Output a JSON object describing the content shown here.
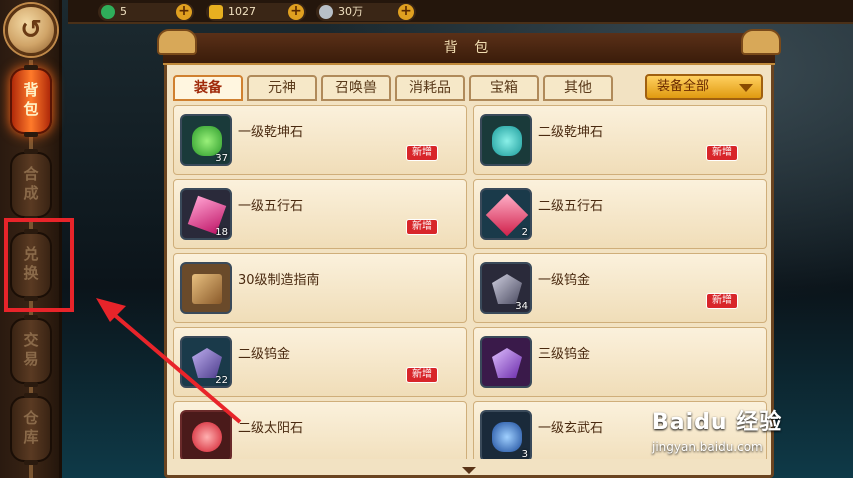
{
  "resources": [
    {
      "name": "jade",
      "value": "5",
      "icon": "jade-icon",
      "color": "#2fae5a"
    },
    {
      "name": "gold",
      "value": "1027",
      "icon": "gold-ingot-icon",
      "color": "#e8b020"
    },
    {
      "name": "silver",
      "value": "30万",
      "icon": "silver-ingot-icon",
      "color": "#b8c0c8"
    }
  ],
  "nav": {
    "back_icon": "back-arrow-icon",
    "items": [
      {
        "label": "背包",
        "active": true
      },
      {
        "label": "合成",
        "active": false
      },
      {
        "label": "兑换",
        "active": false
      },
      {
        "label": "交易",
        "active": false
      },
      {
        "label": "仓库",
        "active": false
      }
    ]
  },
  "panel": {
    "title": "背 包",
    "tabs": [
      "装备",
      "元神",
      "召唤兽",
      "消耗品",
      "宝箱",
      "其他"
    ],
    "active_tab": "装备",
    "filter_label": "装备全部"
  },
  "items": [
    {
      "name": "一级乾坤石",
      "count": "37",
      "new": "新增",
      "color": "#3ac03a"
    },
    {
      "name": "二级乾坤石",
      "count": "",
      "new": "新增",
      "color": "#30c0b0"
    },
    {
      "name": "一级五行石",
      "count": "18",
      "new": "新增",
      "color": "#e0408a"
    },
    {
      "name": "二级五行石",
      "count": "2",
      "new": "",
      "color": "#e84a70"
    },
    {
      "name": "30级制造指南",
      "count": "",
      "new": "",
      "color": "#a8763a"
    },
    {
      "name": "一级钨金",
      "count": "34",
      "new": "新增",
      "color": "#7a7a90"
    },
    {
      "name": "二级钨金",
      "count": "22",
      "new": "新增",
      "color": "#7a6aa8"
    },
    {
      "name": "三级钨金",
      "count": "",
      "new": "",
      "color": "#9a5ac8"
    },
    {
      "name": "二级太阳石",
      "count": "",
      "new": "",
      "color": "#e8303a"
    },
    {
      "name": "一级玄武石",
      "count": "3",
      "new": "",
      "color": "#3a7ad8"
    }
  ],
  "watermark": {
    "main": "Baidu 经验",
    "sub": "jingyan.baidu.com"
  },
  "colors": {
    "highlight": "#e8242a",
    "badge_new": "#d8262a"
  }
}
